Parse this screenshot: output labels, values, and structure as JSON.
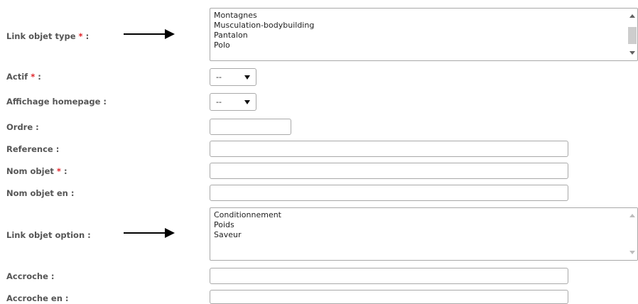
{
  "form": {
    "link_objet_type": {
      "label": "Link objet type",
      "required_mark": "*",
      "colon": ":",
      "options": [
        "Montagnes",
        "Musculation-bodybuilding",
        "Pantalon",
        "Polo"
      ]
    },
    "actif": {
      "label": "Actif",
      "required_mark": "*",
      "colon": ":",
      "value": "--"
    },
    "affichage_homepage": {
      "label": "Affichage homepage :",
      "value": "--"
    },
    "ordre": {
      "label": "Ordre :",
      "value": ""
    },
    "reference": {
      "label": "Reference :",
      "value": ""
    },
    "nom_objet": {
      "label": "Nom objet",
      "required_mark": "*",
      "colon": ":",
      "value": ""
    },
    "nom_objet_en": {
      "label": "Nom objet en :",
      "value": ""
    },
    "link_objet_option": {
      "label": "Link objet option :",
      "options": [
        "Conditionnement",
        "Poids",
        "Saveur"
      ]
    },
    "accroche": {
      "label": "Accroche :",
      "value": ""
    },
    "accroche_en": {
      "label": "Accroche en :",
      "value": ""
    }
  },
  "colors": {
    "label_text": "#555555",
    "required_mark": "#e0242a",
    "field_border": "#a9a9a9",
    "annotation_arrow": "#000000"
  },
  "icons": {
    "annotation": "arrow-right-icon",
    "select_caret": "caret-down-icon",
    "scroll_up": "scroll-up-icon",
    "scroll_down": "scroll-down-icon"
  }
}
